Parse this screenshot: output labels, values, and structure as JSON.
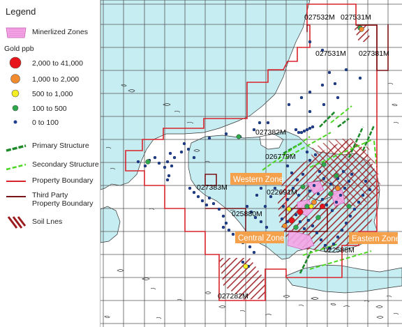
{
  "legend": {
    "title": "Legend",
    "mineralized_label": "Minerlized Zones",
    "gold_header": "Gold ppb",
    "gold_classes": [
      {
        "label": "2,000 to 41,000",
        "color": "#e8141b"
      },
      {
        "label": "1,000 to 2,000",
        "color": "#f28a2e"
      },
      {
        "label": "500 to 1,000",
        "color": "#f5ee22"
      },
      {
        "label": "100 to 500",
        "color": "#2ea84a"
      },
      {
        "label": "0 to 100",
        "color": "#1f3f8f"
      }
    ],
    "primary_structure": "Primary Structure",
    "secondary_structure": "Secondary Structure",
    "property_boundary": "Property Boundary",
    "third_party_line1": "Third Party",
    "third_party_line2": "Property Boundary",
    "soil_lines": "Soil Lnes"
  },
  "claims": [
    "027532M",
    "027531M",
    "027531M",
    "027381M",
    "027382M",
    "026779M",
    "027383M",
    "022691M",
    "025880M",
    "022588M",
    "027282M"
  ],
  "zones": [
    "Western Zone",
    "Central Zone",
    "Eastern Zone"
  ],
  "colors": {
    "water": "#c6edf2",
    "property_boundary": "#d8232a",
    "third_party": "#7a1216",
    "soil_hatch": "#9b1b1f",
    "mineralized": "#f4a6e6",
    "primary_structure": "#1f8a2a",
    "secondary_structure": "#4bd620",
    "zone_label_bg": "#f5a04a"
  }
}
